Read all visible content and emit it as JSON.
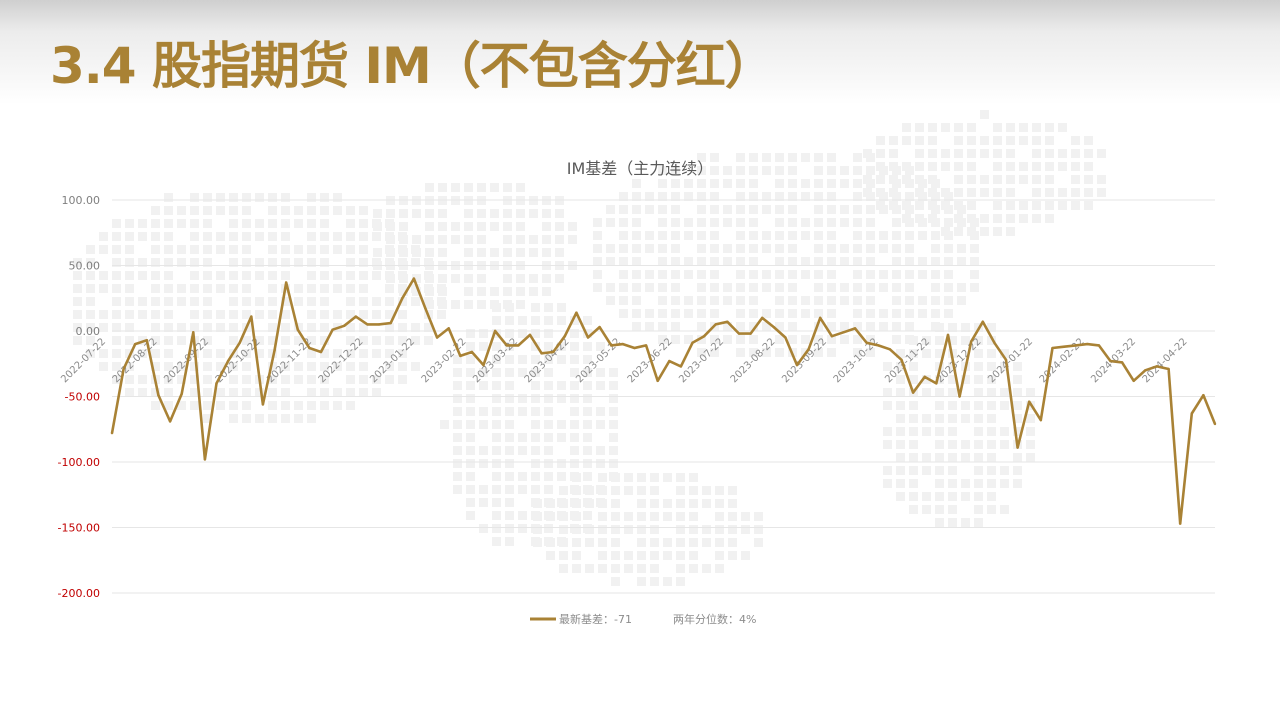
{
  "slide": {
    "title": "3.4 股指期货 IM（不包含分红）"
  },
  "colors": {
    "accent": "#a98235",
    "title": "#a98235",
    "negative_tick": "#c00000",
    "positive_tick": "#7f7f7f",
    "grid": "#e6e6e6"
  },
  "chart_data": {
    "type": "line",
    "title": "IM基差（主力连续）",
    "ylim": [
      -200,
      100
    ],
    "yticks": [
      100,
      50,
      0,
      -50,
      -100,
      -150,
      -200
    ],
    "ytick_labels": [
      "100.00",
      "50.00",
      "0.00",
      "-50.00",
      "-100.00",
      "-150.00",
      "-200.00"
    ],
    "grid": true,
    "legend_position": "bottom",
    "x_tick_labels": [
      "2022-07-22",
      "2022-08-22",
      "2022-09-22",
      "2022-10-22",
      "2022-11-22",
      "2022-12-22",
      "2023-01-22",
      "2023-02-22",
      "2023-03-22",
      "2023-04-22",
      "2023-05-22",
      "2023-06-22",
      "2023-07-22",
      "2023-08-22",
      "2023-09-22",
      "2023-10-22",
      "2023-11-22",
      "2023-12-22",
      "2024-01-22",
      "2024-02-22",
      "2024-03-22",
      "2024-04-22"
    ],
    "series": [
      {
        "name": "最新基差：-71",
        "values": [
          -78,
          -29,
          -10,
          -7,
          -49,
          -69,
          -48,
          -1,
          -98,
          -40,
          -23,
          -9,
          11,
          -56,
          -15,
          37,
          1,
          -13,
          -16,
          1,
          4,
          11,
          5,
          5,
          6,
          25,
          40,
          17,
          -5,
          2,
          -19,
          -16,
          -26,
          0,
          -11,
          -11,
          -3,
          -17,
          -16,
          -4,
          14,
          -5,
          3,
          -11,
          -10,
          -13,
          -11,
          -38,
          -23,
          -27,
          -9,
          -4,
          5,
          7,
          -2,
          -2,
          10,
          3,
          -5,
          -26,
          -14,
          10,
          -4,
          -1,
          2,
          -9,
          -11,
          -14,
          -22,
          -47,
          -35,
          -40,
          -3,
          -50,
          -8,
          7,
          -9,
          -22,
          -89,
          -54,
          -68,
          -13,
          -12,
          -11,
          -10,
          -11,
          -23,
          -24,
          -38,
          -30,
          -27,
          -29,
          -147,
          -63,
          -49,
          -71
        ]
      }
    ],
    "annotations": [
      "两年分位数：4%"
    ]
  }
}
